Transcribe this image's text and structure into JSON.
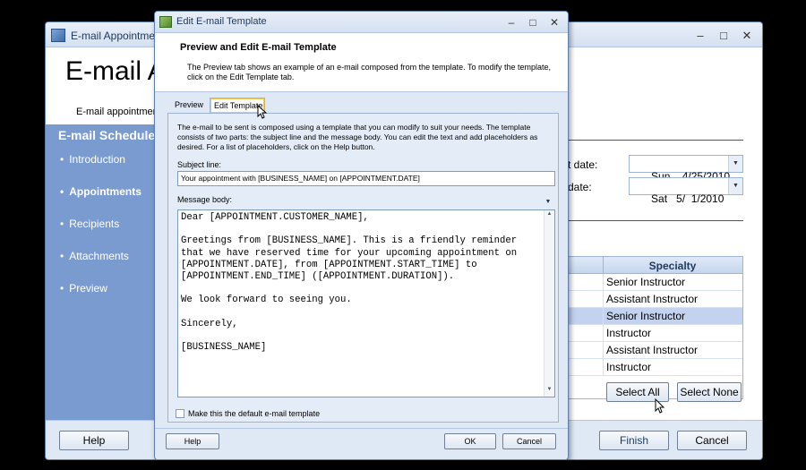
{
  "background_window": {
    "title": "E-mail Appointme",
    "header_title": "E-mail A",
    "header_subtitle": "E-mail appointmen",
    "sidebar": {
      "heading": "E-mail Schedule",
      "items": [
        {
          "label": "Introduction",
          "active": false
        },
        {
          "label": "Appointments",
          "active": true
        },
        {
          "label": "Recipients",
          "active": false
        },
        {
          "label": "Attachments",
          "active": false
        },
        {
          "label": "Preview",
          "active": false
        }
      ]
    },
    "start_date_label": "t date:",
    "start_date_value": "Sun    4/25/2010",
    "end_date_label": "date:",
    "end_date_value": "Sat   5/  1/2010",
    "grid_header": "Specialty",
    "grid_rows": [
      "Senior Instructor",
      "Assistant Instructor",
      "Senior Instructor",
      "Instructor",
      "Assistant Instructor",
      "Instructor"
    ],
    "select_all_label": "Select All",
    "select_none_label": "Select None",
    "help_label": "Help",
    "finish_label": "Finish",
    "cancel_label": "Cancel"
  },
  "dialog": {
    "title": "Edit E-mail Template",
    "header_title": "Preview and Edit E-mail Template",
    "header_desc": "The Preview tab shows an example of an e-mail composed from the template. To modify the template, click on the Edit Template tab.",
    "tabs": [
      "Preview",
      "Edit Template"
    ],
    "panel_desc": "The e-mail to be sent is composed using a template that you can modify to suit your needs.  The template consists of two parts:  the subject line and the message body.  You can edit the text and add placeholders as desired. For a list of placeholders, click on the Help button.",
    "subject_label": "Subject line:",
    "subject_value": "Your appointment with [BUSINESS_NAME] on [APPOINTMENT.DATE]",
    "body_label": "Message body:",
    "body_value": "Dear [APPOINTMENT.CUSTOMER_NAME],\n\nGreetings from [BUSINESS_NAME]. This is a friendly reminder\nthat we have reserved time for your upcoming appointment on\n[APPOINTMENT.DATE], from [APPOINTMENT.START_TIME] to\n[APPOINTMENT.END_TIME] ([APPOINTMENT.DURATION]).\n\nWe look forward to seeing you.\n\nSincerely,\n\n[BUSINESS_NAME]",
    "default_checkbox_label": "Make this the default e-mail template",
    "default_checked": false,
    "help_label": "Help",
    "ok_label": "OK",
    "cancel_label": "Cancel"
  }
}
